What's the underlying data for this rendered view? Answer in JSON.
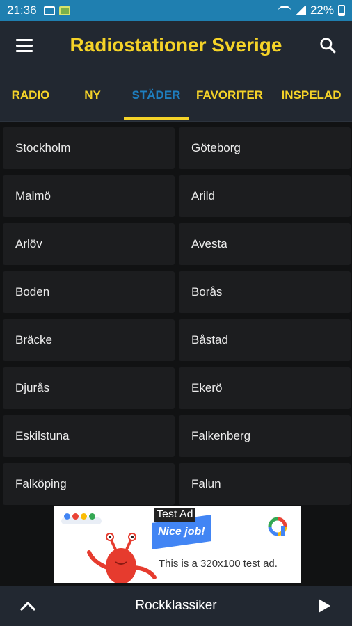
{
  "status_bar": {
    "time": "21:36",
    "battery": "22%",
    "icons": [
      "gallery-icon",
      "app-notification-icon",
      "wifi-icon",
      "signal-icon",
      "battery-icon"
    ]
  },
  "app_bar": {
    "title": "Radiostationer Sverige",
    "menu_icon": "hamburger-menu-icon",
    "search_icon": "search-icon"
  },
  "tabs": [
    {
      "label": "RADIO",
      "active": false
    },
    {
      "label": "NY",
      "active": false
    },
    {
      "label": "STÄDER",
      "active": true
    },
    {
      "label": "FAVORITER",
      "active": false
    },
    {
      "label": "INSPELAD",
      "active": false
    }
  ],
  "cities": [
    "Stockholm",
    "Göteborg",
    "Malmö",
    "Arild",
    "Arlöv",
    "Avesta",
    "Boden",
    "Borås",
    "Bräcke",
    "Båstad",
    "Djurås",
    "Ekerö",
    "Eskilstuna",
    "Falkenberg",
    "Falköping",
    "Falun"
  ],
  "ad": {
    "tag": "Test Ad",
    "banner": "Nice job!",
    "text": "This is a 320x100 test ad."
  },
  "player": {
    "station": "Rockklassiker",
    "expand_icon": "chevron-up-icon",
    "play_icon": "play-icon"
  },
  "colors": {
    "accent": "#f5d328",
    "active_tab": "#1e7fc0",
    "status_bar": "#1f7fb0",
    "toolbar": "#222831",
    "cell": "#1c1d1f"
  }
}
